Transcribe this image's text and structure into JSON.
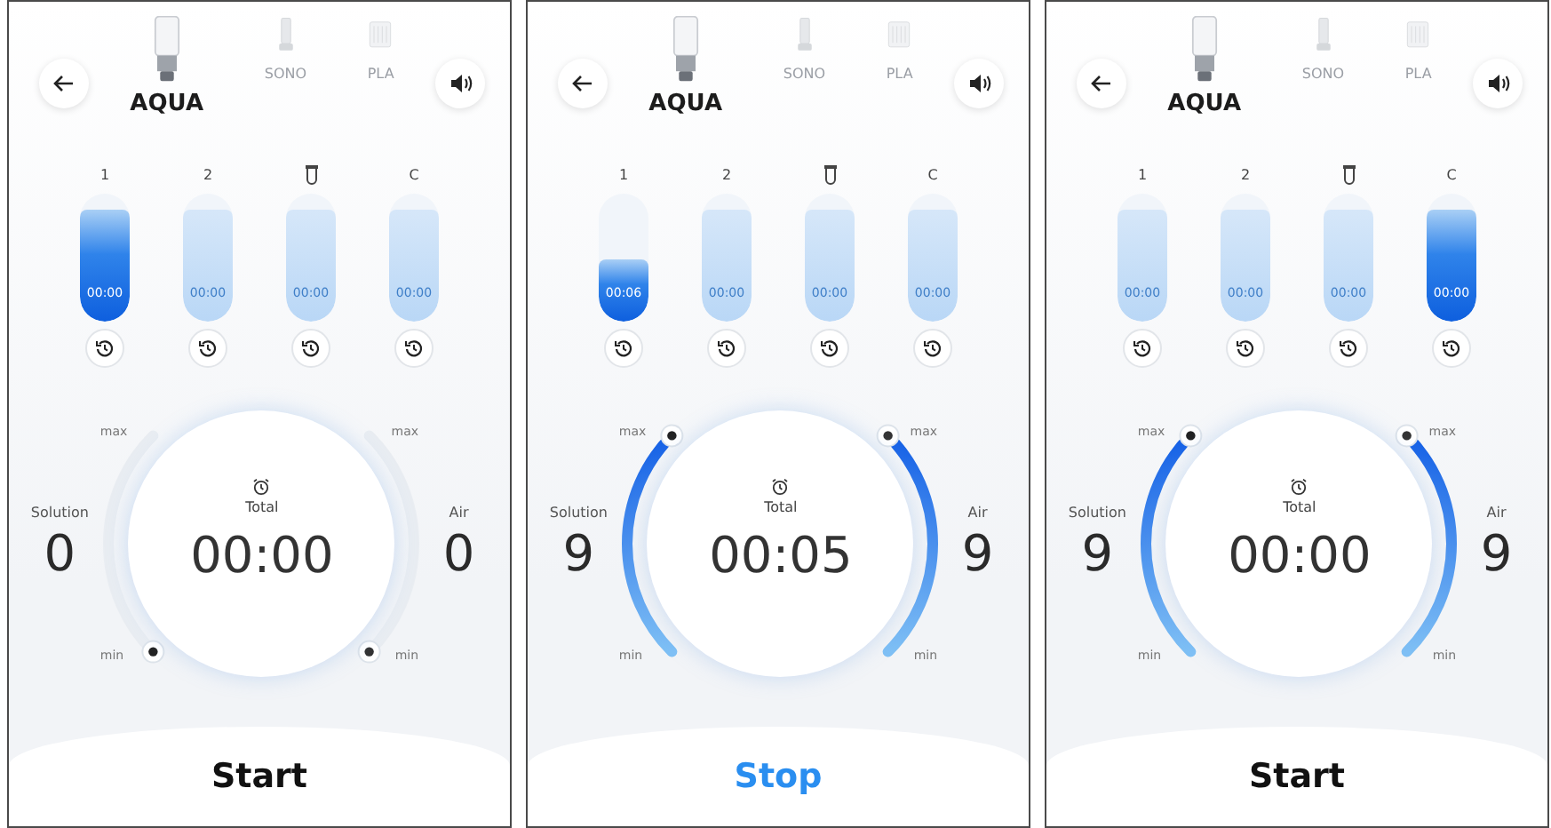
{
  "screens": [
    {
      "modes": [
        {
          "label": "AQUA",
          "selected": true
        },
        {
          "label": "SONO",
          "selected": false
        },
        {
          "label": "PLA",
          "selected": false
        }
      ],
      "vials": [
        {
          "kind": "number",
          "label": "1",
          "time": "00:00",
          "selected": true,
          "level": 0.88
        },
        {
          "kind": "number",
          "label": "2",
          "time": "00:00",
          "selected": false,
          "level": 0.88
        },
        {
          "kind": "tube-icon",
          "time": "00:00",
          "selected": false,
          "level": 0.88
        },
        {
          "kind": "number",
          "label": "C",
          "time": "00:00",
          "selected": false,
          "level": 0.88
        }
      ],
      "solution": {
        "label": "Solution",
        "value": "0",
        "level": 0,
        "max_label": "max",
        "min_label": "min"
      },
      "air": {
        "label": "Air",
        "value": "0",
        "level": 0,
        "max_label": "max",
        "min_label": "min"
      },
      "total": {
        "label": "Total",
        "time": "00:00"
      },
      "action": {
        "label": "Start",
        "running": false
      }
    },
    {
      "modes": [
        {
          "label": "AQUA",
          "selected": true
        },
        {
          "label": "SONO",
          "selected": false
        },
        {
          "label": "PLA",
          "selected": false
        }
      ],
      "vials": [
        {
          "kind": "number",
          "label": "1",
          "time": "00:06",
          "selected": true,
          "level": 0.48
        },
        {
          "kind": "number",
          "label": "2",
          "time": "00:00",
          "selected": false,
          "level": 0.88
        },
        {
          "kind": "tube-icon",
          "time": "00:00",
          "selected": false,
          "level": 0.88
        },
        {
          "kind": "number",
          "label": "C",
          "time": "00:00",
          "selected": false,
          "level": 0.88
        }
      ],
      "solution": {
        "label": "Solution",
        "value": "9",
        "level": 1,
        "max_label": "max",
        "min_label": "min"
      },
      "air": {
        "label": "Air",
        "value": "9",
        "level": 1,
        "max_label": "max",
        "min_label": "min"
      },
      "total": {
        "label": "Total",
        "time": "00:05"
      },
      "action": {
        "label": "Stop",
        "running": true
      }
    },
    {
      "modes": [
        {
          "label": "AQUA",
          "selected": true
        },
        {
          "label": "SONO",
          "selected": false
        },
        {
          "label": "PLA",
          "selected": false
        }
      ],
      "vials": [
        {
          "kind": "number",
          "label": "1",
          "time": "00:00",
          "selected": false,
          "level": 0.88
        },
        {
          "kind": "number",
          "label": "2",
          "time": "00:00",
          "selected": false,
          "level": 0.88
        },
        {
          "kind": "tube-icon",
          "time": "00:00",
          "selected": false,
          "level": 0.88
        },
        {
          "kind": "number",
          "label": "C",
          "time": "00:00",
          "selected": true,
          "level": 0.88
        }
      ],
      "solution": {
        "label": "Solution",
        "value": "9",
        "level": 1,
        "max_label": "max",
        "min_label": "min"
      },
      "air": {
        "label": "Air",
        "value": "9",
        "level": 1,
        "max_label": "max",
        "min_label": "min"
      },
      "total": {
        "label": "Total",
        "time": "00:00"
      },
      "action": {
        "label": "Start",
        "running": false
      }
    }
  ]
}
